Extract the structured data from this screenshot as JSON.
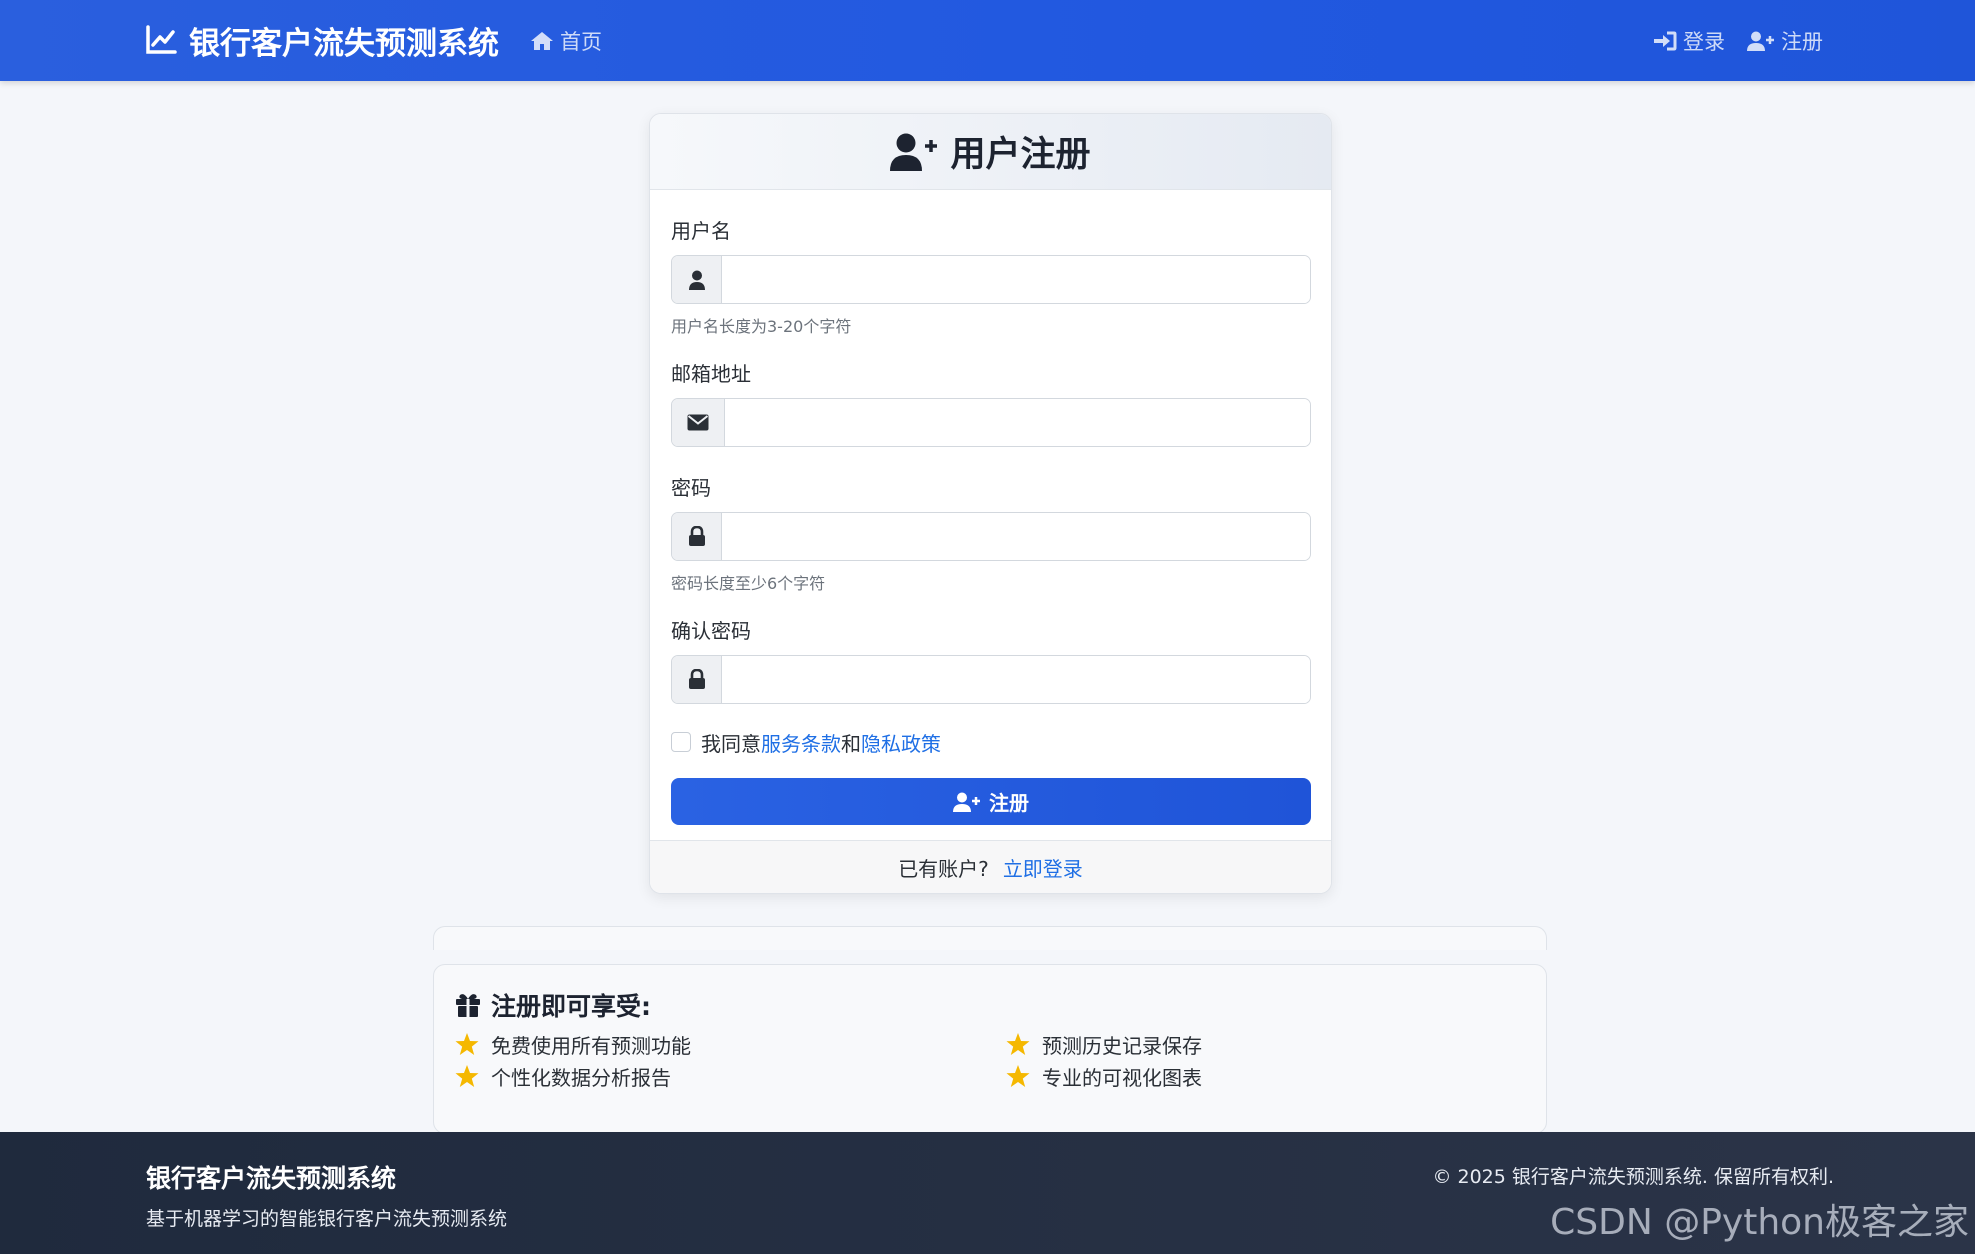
{
  "navbar": {
    "brand": "银行客户流失预测系统",
    "home": "首页",
    "login": "登录",
    "register": "注册"
  },
  "card": {
    "title": "用户注册",
    "username_label": "用户名",
    "username_hint": "用户名长度为3-20个字符",
    "email_label": "邮箱地址",
    "password_label": "密码",
    "password_hint": "密码长度至少6个字符",
    "confirm_label": "确认密码",
    "agree_prefix": "我同意",
    "terms_link": "服务条款",
    "agree_and": "和",
    "privacy_link": "隐私政策",
    "submit": "注册",
    "footer_text": "已有账户?",
    "footer_link": "立即登录"
  },
  "benefits": {
    "title": "注册即可享受:",
    "items": [
      "免费使用所有预测功能",
      "预测历史记录保存",
      "个性化数据分析报告",
      "专业的可视化图表"
    ]
  },
  "footer": {
    "title": "银行客户流失预测系统",
    "subtitle": "基于机器学习的智能银行客户流失预测系统",
    "copyright": "© 2025 银行客户流失预测系统. 保留所有权利."
  },
  "watermark": "CSDN @Python极客之家",
  "colors": {
    "navbar": "#2158e0",
    "primary": "#1f54d8",
    "link": "#1f6fe5",
    "star": "#f5b800",
    "footer": "#1f2a3d"
  }
}
